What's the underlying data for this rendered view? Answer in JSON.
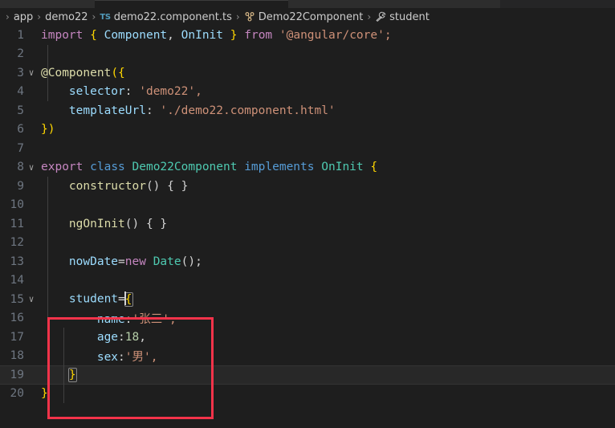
{
  "window": {
    "theme": "dark-plus",
    "background": "#1e1e1e",
    "annotation_color": "#f4334a"
  },
  "tabs": [
    {
      "label": "",
      "active": false
    },
    {
      "label": "",
      "active": true
    },
    {
      "label": "",
      "active": false
    }
  ],
  "breadcrumb": {
    "separator": "›",
    "items": [
      {
        "label": "app",
        "icon": ""
      },
      {
        "label": "demo22",
        "icon": ""
      },
      {
        "label": "demo22.component.ts",
        "icon": "typescript-file-icon"
      },
      {
        "label": "Demo22Component",
        "icon": "class-symbol-icon"
      },
      {
        "label": "student",
        "icon": "property-symbol-icon"
      }
    ]
  },
  "editor": {
    "language": "typescript",
    "file": "demo22.component.ts",
    "active_line": 19,
    "lines": [
      {
        "number": "1",
        "folded": false,
        "fold": false
      },
      {
        "number": "2",
        "folded": false,
        "fold": false
      },
      {
        "number": "3",
        "folded": false,
        "fold": true
      },
      {
        "number": "4",
        "folded": false,
        "fold": false
      },
      {
        "number": "5",
        "folded": false,
        "fold": false
      },
      {
        "number": "6",
        "folded": false,
        "fold": false
      },
      {
        "number": "7",
        "folded": false,
        "fold": false
      },
      {
        "number": "8",
        "folded": false,
        "fold": true
      },
      {
        "number": "9",
        "folded": false,
        "fold": false
      },
      {
        "number": "10",
        "folded": false,
        "fold": false
      },
      {
        "number": "11",
        "folded": false,
        "fold": false
      },
      {
        "number": "12",
        "folded": false,
        "fold": false
      },
      {
        "number": "13",
        "folded": false,
        "fold": false
      },
      {
        "number": "14",
        "folded": false,
        "fold": false
      },
      {
        "number": "15",
        "folded": false,
        "fold": true
      },
      {
        "number": "16",
        "folded": false,
        "fold": false
      },
      {
        "number": "17",
        "folded": false,
        "fold": false
      },
      {
        "number": "18",
        "folded": false,
        "fold": false
      },
      {
        "number": "19",
        "folded": false,
        "fold": false
      },
      {
        "number": "20",
        "folded": false,
        "fold": false
      }
    ],
    "source": {
      "l1": "import { Component, OnInit } from '@angular/core';",
      "l2": "",
      "l3": "@Component({",
      "l4": "    selector: 'demo22',",
      "l5": "    templateUrl: './demo22.component.html'",
      "l6": "})",
      "l7": "",
      "l8": "export class Demo22Component implements OnInit {",
      "l9": "    constructor() { }",
      "l10": "",
      "l11": "    ngOnInit() { }",
      "l12": "",
      "l13": "    nowDate=new Date();",
      "l14": "",
      "l15": "    student={",
      "l16": "        name:'张三',",
      "l17": "        age:18,",
      "l18": "        sex:'男',",
      "l19": "    }",
      "l20": "}"
    },
    "tokens": {
      "import": "import",
      "brace_open": "{",
      "brace_close": "}",
      "component": "Component",
      "comma": ",",
      "oninit": "OnInit",
      "from": "from",
      "angular_core": "'@angular/core';",
      "decorator_component": "@Component",
      "paren_brace_open": "({",
      "selector_key": "selector",
      "colon": ":",
      "selector_value": "'demo22',",
      "templateurl_key": "templateUrl",
      "templateurl_value": "'./demo22.component.html'",
      "brace_paren_close": "})",
      "export": "export",
      "class": "class",
      "classname": "Demo22Component",
      "implements": "implements",
      "constructor": "constructor",
      "empty_block": "() { }",
      "ngoninit": "ngOnInit",
      "nowdate": "nowDate",
      "equals": "=",
      "new": "new",
      "date": "Date",
      "call_end": "();",
      "student": "student",
      "name_key": "name",
      "name_value": "'张三',",
      "age_key": "age",
      "age_value": "18",
      "sex_key": "sex",
      "sex_value": "'男',",
      "trailing_comma": ",",
      "open_brace": "{",
      "close_brace": "}",
      "space": " "
    }
  },
  "icons": {
    "chevron_down": "∨",
    "chevron_right": "›"
  }
}
